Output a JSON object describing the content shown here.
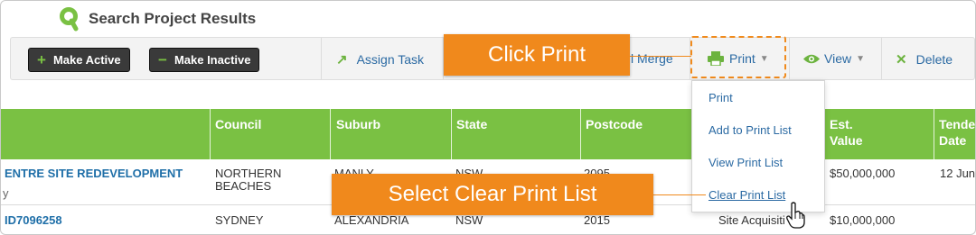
{
  "header": {
    "title": "Search Project Results",
    "icon": "search-q-icon"
  },
  "toolbar": {
    "make_active": "Make Active",
    "make_inactive": "Make Inactive",
    "assign_task": "Assign Task",
    "mail_merge": "Mail Merge",
    "mail_merge_visible": "l Merge",
    "print": "Print",
    "view": "View",
    "delete": "Delete"
  },
  "callouts": {
    "click_print": "Click Print",
    "select_clear": "Select Clear Print List"
  },
  "print_menu": {
    "items": [
      "Print",
      "Add to Print List",
      "View Print List",
      "Clear Print List"
    ]
  },
  "table": {
    "columns": [
      "Council",
      "Suburb",
      "State",
      "Postcode",
      "Est.\nValue",
      "Tende\nDate"
    ],
    "col_est_1": "Est.",
    "col_est_2": "Value",
    "col_tender_1": "Tende",
    "col_tender_2": "Date",
    "rows": [
      {
        "project": "ENTRE SITE REDEVELOPMENT",
        "project_sub": "y",
        "council_1": "NORTHERN",
        "council_2": "BEACHES",
        "suburb": "MANLY",
        "state": "NSW",
        "postcode": "2095",
        "value": "$50,000,000",
        "tender": "12 Jun"
      },
      {
        "project": "ID7096258",
        "council": "SYDNEY",
        "suburb": "ALEXANDRIA",
        "state": "NSW",
        "postcode": "2015",
        "stage": "Site Acquisiti",
        "value": "$10,000,000"
      }
    ]
  },
  "colors": {
    "accent_green": "#7ac143",
    "callout_orange": "#f0891c",
    "link_blue": "#2b6aa3"
  }
}
